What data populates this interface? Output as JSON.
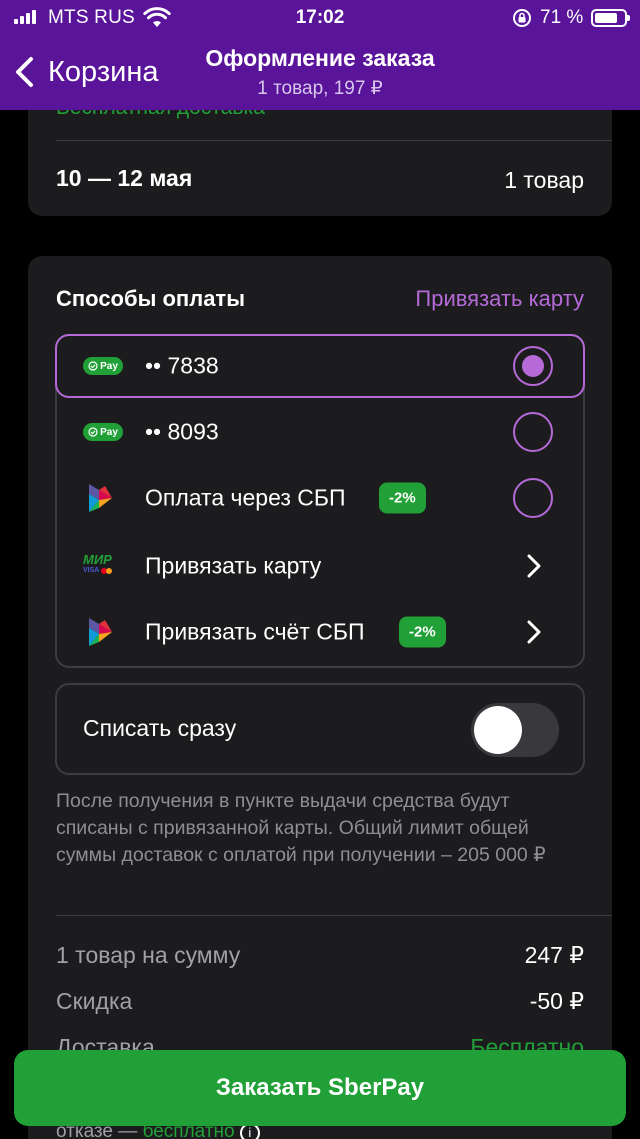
{
  "status_bar": {
    "carrier": "MTS RUS",
    "time": "17:02",
    "battery": "71 %"
  },
  "nav": {
    "back_label": "Корзина",
    "title": "Оформление заказа",
    "subtitle": "1 товар, 197 ₽"
  },
  "delivery": {
    "free_label": "Бесплатная доставка",
    "dates": "10 — 12 мая",
    "items": "1 товар"
  },
  "payment": {
    "title": "Способы оплаты",
    "link_card": "Привязать карту",
    "methods": [
      {
        "icon": "sberpay-icon",
        "label": "•• 7838",
        "control": "radio",
        "selected": true
      },
      {
        "icon": "sberpay-icon",
        "label": "•• 8093",
        "control": "radio",
        "selected": false
      },
      {
        "icon": "sbp-icon",
        "label": "Оплата через СБП",
        "badge": "-2%",
        "control": "radio",
        "selected": false
      },
      {
        "icon": "mir-card-icon",
        "label": "Привязать карту",
        "control": "chevron"
      },
      {
        "icon": "sbp-icon",
        "label": "Привязать счёт СБП",
        "badge": "-2%",
        "control": "chevron"
      }
    ],
    "sberpay_pill_text": "Pay",
    "mir_text": "МИР",
    "visa_text": "VISA"
  },
  "charge_now": {
    "label": "Списать сразу",
    "enabled": false
  },
  "note": "После получения в пункте выдачи средства будут списаны с привязанной карты. Общий лимит общей суммы доставок с оплатой при получении – 205 000 ₽",
  "summary": {
    "rows": [
      {
        "label": "1 товар на сумму",
        "value": "247 ₽"
      },
      {
        "label": "Скидка",
        "value": "-50 ₽"
      },
      {
        "label": "Доставка",
        "value": "Бесплатно"
      }
    ],
    "refusal_text": "отказе —",
    "refusal_value": "бесплатно"
  },
  "colors": {
    "accent_purple": "#5a149a",
    "link_purple": "#b56ad8",
    "sber_green": "#21a038",
    "card_bg": "#1c1c1e"
  },
  "order_button": "Заказать SberPay"
}
